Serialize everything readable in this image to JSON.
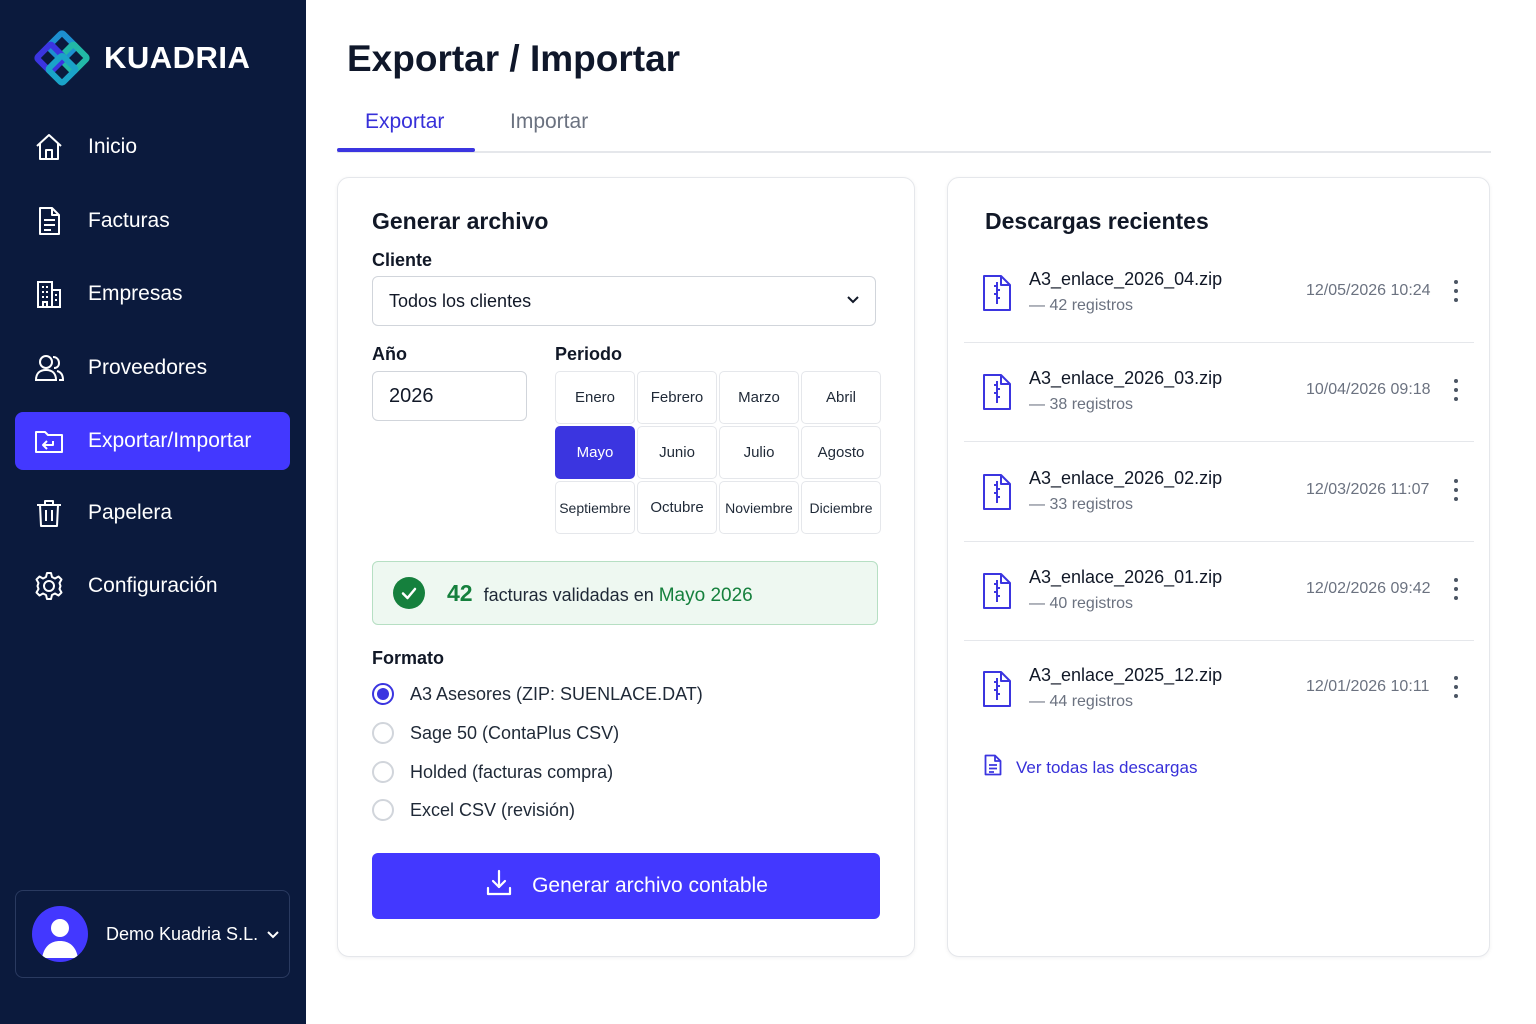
{
  "app": {
    "logo_text": "KUADRIA",
    "accent_color": "#4338ff",
    "sidebar_color": "#0b1a3d",
    "success_color": "#15803d"
  },
  "sidebar": {
    "items": [
      {
        "label": "Inicio",
        "icon": "home-icon"
      },
      {
        "label": "Facturas",
        "icon": "invoice-icon"
      },
      {
        "label": "Empresas",
        "icon": "building-icon"
      },
      {
        "label": "Proveedores",
        "icon": "users-icon"
      },
      {
        "label": "Exportar/Importar",
        "icon": "folder-transfer-icon",
        "active": true
      },
      {
        "label": "Papelera",
        "icon": "trash-icon"
      },
      {
        "label": "Configuración",
        "icon": "gear-icon"
      }
    ],
    "user": {
      "name": "Demo Kuadria S.L.",
      "icon": "avatar-icon"
    }
  },
  "page": {
    "title": "Exportar / Importar",
    "tabs": [
      {
        "label": "Exportar",
        "active": true
      },
      {
        "label": "Importar",
        "active": false
      }
    ]
  },
  "generate": {
    "title": "Generar archivo",
    "client_label": "Cliente",
    "client_value": "Todos los clientes",
    "year_label": "Año",
    "year_value": "2026",
    "period_label": "Periodo",
    "months": [
      "Enero",
      "Febrero",
      "Marzo",
      "Abril",
      "Mayo",
      "Junio",
      "Julio",
      "Agosto",
      "Septiembre",
      "Octubre",
      "Noviembre",
      "Diciembre"
    ],
    "selected_month": "Mayo",
    "status": {
      "count": "42",
      "text": "facturas validadas en",
      "period": "Mayo 2026"
    },
    "format_label": "Formato",
    "formats": [
      {
        "label": "A3 Asesores (ZIP: SUENLACE.DAT)",
        "checked": true
      },
      {
        "label": "Sage 50 (ContaPlus CSV)",
        "checked": false
      },
      {
        "label": "Holded (facturas compra)",
        "checked": false
      },
      {
        "label": "Excel CSV (revisión)",
        "checked": false
      }
    ],
    "button_label": "Generar archivo contable"
  },
  "downloads": {
    "title": "Descargas recientes",
    "items": [
      {
        "name": "A3_enlace_2026_04.zip",
        "count": "— 42 registros",
        "date": "12/05/2026 10:24"
      },
      {
        "name": "A3_enlace_2026_03.zip",
        "count": "— 38 registros",
        "date": "10/04/2026 09:18"
      },
      {
        "name": "A3_enlace_2026_02.zip",
        "count": "— 33 registros",
        "date": "12/03/2026 11:07"
      },
      {
        "name": "A3_enlace_2026_01.zip",
        "count": "— 40 registros",
        "date": "12/02/2026 09:42"
      },
      {
        "name": "A3_enlace_2025_12.zip",
        "count": "— 44 registros",
        "date": "12/01/2026 10:11"
      }
    ],
    "see_all_label": "Ver todas las descargas"
  }
}
